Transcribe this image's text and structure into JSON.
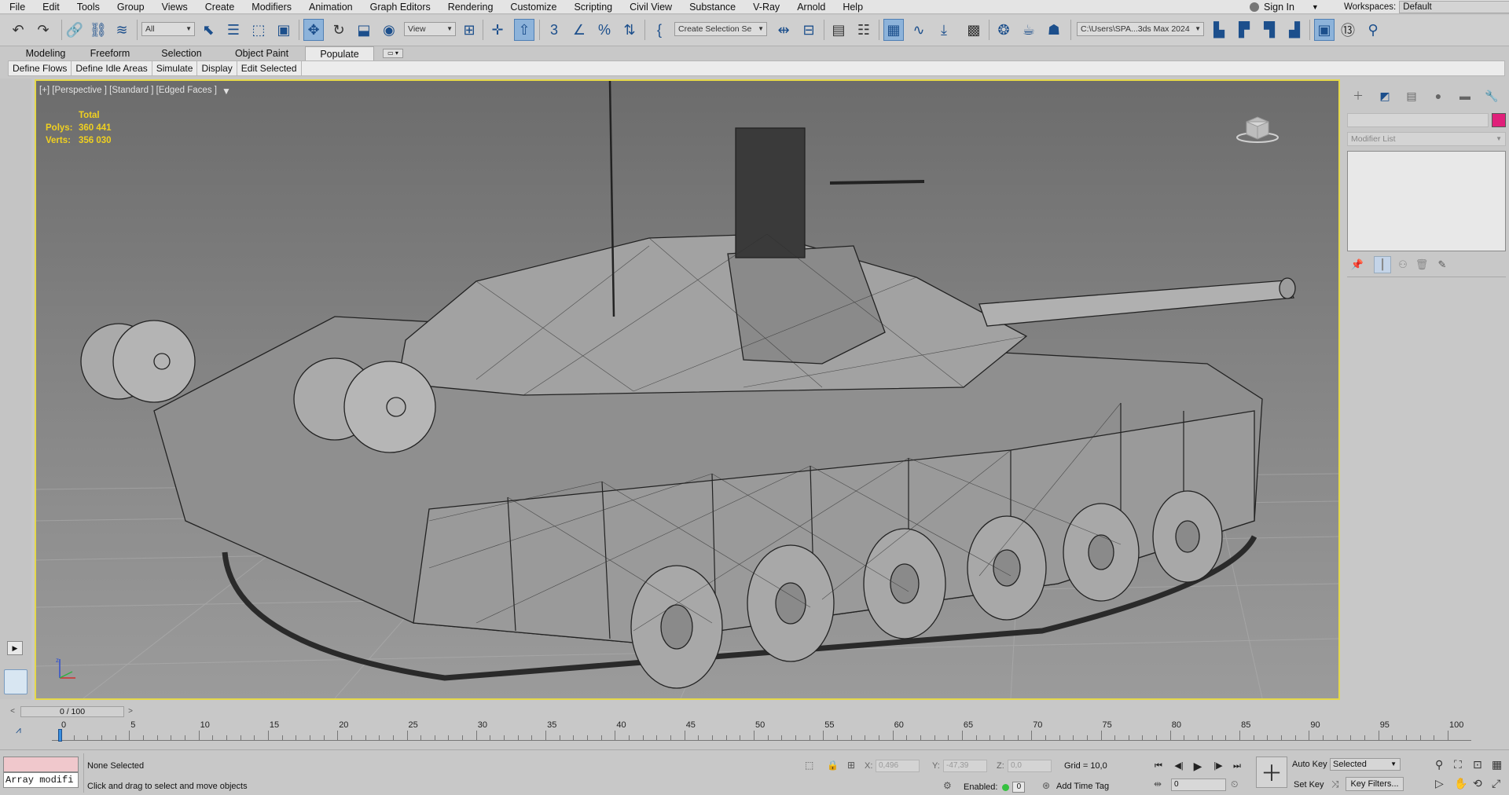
{
  "menubar": {
    "items": [
      "File",
      "Edit",
      "Tools",
      "Group",
      "Views",
      "Create",
      "Modifiers",
      "Animation",
      "Graph Editors",
      "Rendering",
      "Customize",
      "Scripting",
      "Civil View",
      "Substance",
      "V-Ray",
      "Arnold",
      "Help"
    ],
    "sign_in": "Sign In",
    "workspaces_label": "Workspaces:",
    "workspace_value": "Default"
  },
  "toolbar": {
    "selection_filter": "All",
    "ref_coord": "View",
    "named_selection": "Create Selection Se",
    "project_path": "C:\\Users\\SPA...3ds Max 2024",
    "icons": [
      "undo-icon",
      "redo-icon",
      "link-icon",
      "unlink-icon",
      "bind-spacewarp-icon",
      "select-object-icon",
      "select-by-name-icon",
      "rect-selection-icon",
      "window-crossing-icon",
      "select-move-icon",
      "select-rotate-icon",
      "select-scale-icon",
      "select-place-icon",
      "snaps-icon",
      "angle-snap-icon",
      "percent-snap-icon",
      "spinner-snap-icon",
      "edit-named-selection-icon",
      "mirror-icon",
      "align-icon",
      "layer-explorer-icon",
      "toggle-ribbon-icon",
      "curve-editor-icon",
      "schematic-view-icon",
      "material-editor-icon",
      "render-setup-icon",
      "rendered-frame-icon",
      "render-icon"
    ],
    "active_icon": "select-move-icon"
  },
  "ribbon": {
    "tabs": [
      "Modeling",
      "Freeform",
      "Selection",
      "Object Paint",
      "Populate"
    ],
    "active_tab": "Populate",
    "populate_items": [
      "Define Flows",
      "Define Idle Areas",
      "Simulate",
      "Display",
      "Edit Selected"
    ]
  },
  "viewport": {
    "label": "[+] [Perspective ] [Standard ] [Edged Faces ]",
    "stats": {
      "total_label": "Total",
      "polys_label": "Polys:",
      "polys_value": "360 441",
      "verts_label": "Verts:",
      "verts_value": "356 030"
    },
    "border_color": "#e5d84a",
    "viewcube_face": "front"
  },
  "command_panel": {
    "tabs": [
      "create-icon",
      "modify-icon",
      "hierarchy-icon",
      "motion-icon",
      "display-icon",
      "utilities-icon"
    ],
    "active_tab": "modify-icon",
    "modifier_list_placeholder": "Modifier List",
    "object_color": "#e0207a"
  },
  "timeline": {
    "frame_display": "0 / 100",
    "ticks": [
      "0",
      "5",
      "10",
      "15",
      "20",
      "25",
      "30",
      "35",
      "40",
      "45",
      "50",
      "55",
      "60",
      "65",
      "70",
      "75",
      "80",
      "85",
      "90",
      "95",
      "100"
    ]
  },
  "statusbar": {
    "maxscript_text": "Array modifi",
    "selection_status": "None Selected",
    "prompt": "Click and drag to select and move objects",
    "x_label": "X:",
    "x_value": "0,496",
    "y_label": "Y:",
    "y_value": "-47,39",
    "z_label": "Z:",
    "z_value": "0,0",
    "grid": "Grid = 10,0",
    "enabled_label": "Enabled:",
    "enabled_value": "0",
    "add_time_tag": "Add Time Tag",
    "frame_value": "0",
    "auto_key": "Auto Key",
    "set_key": "Set Key",
    "key_set_value": "Selected",
    "key_filters": "Key Filters..."
  }
}
